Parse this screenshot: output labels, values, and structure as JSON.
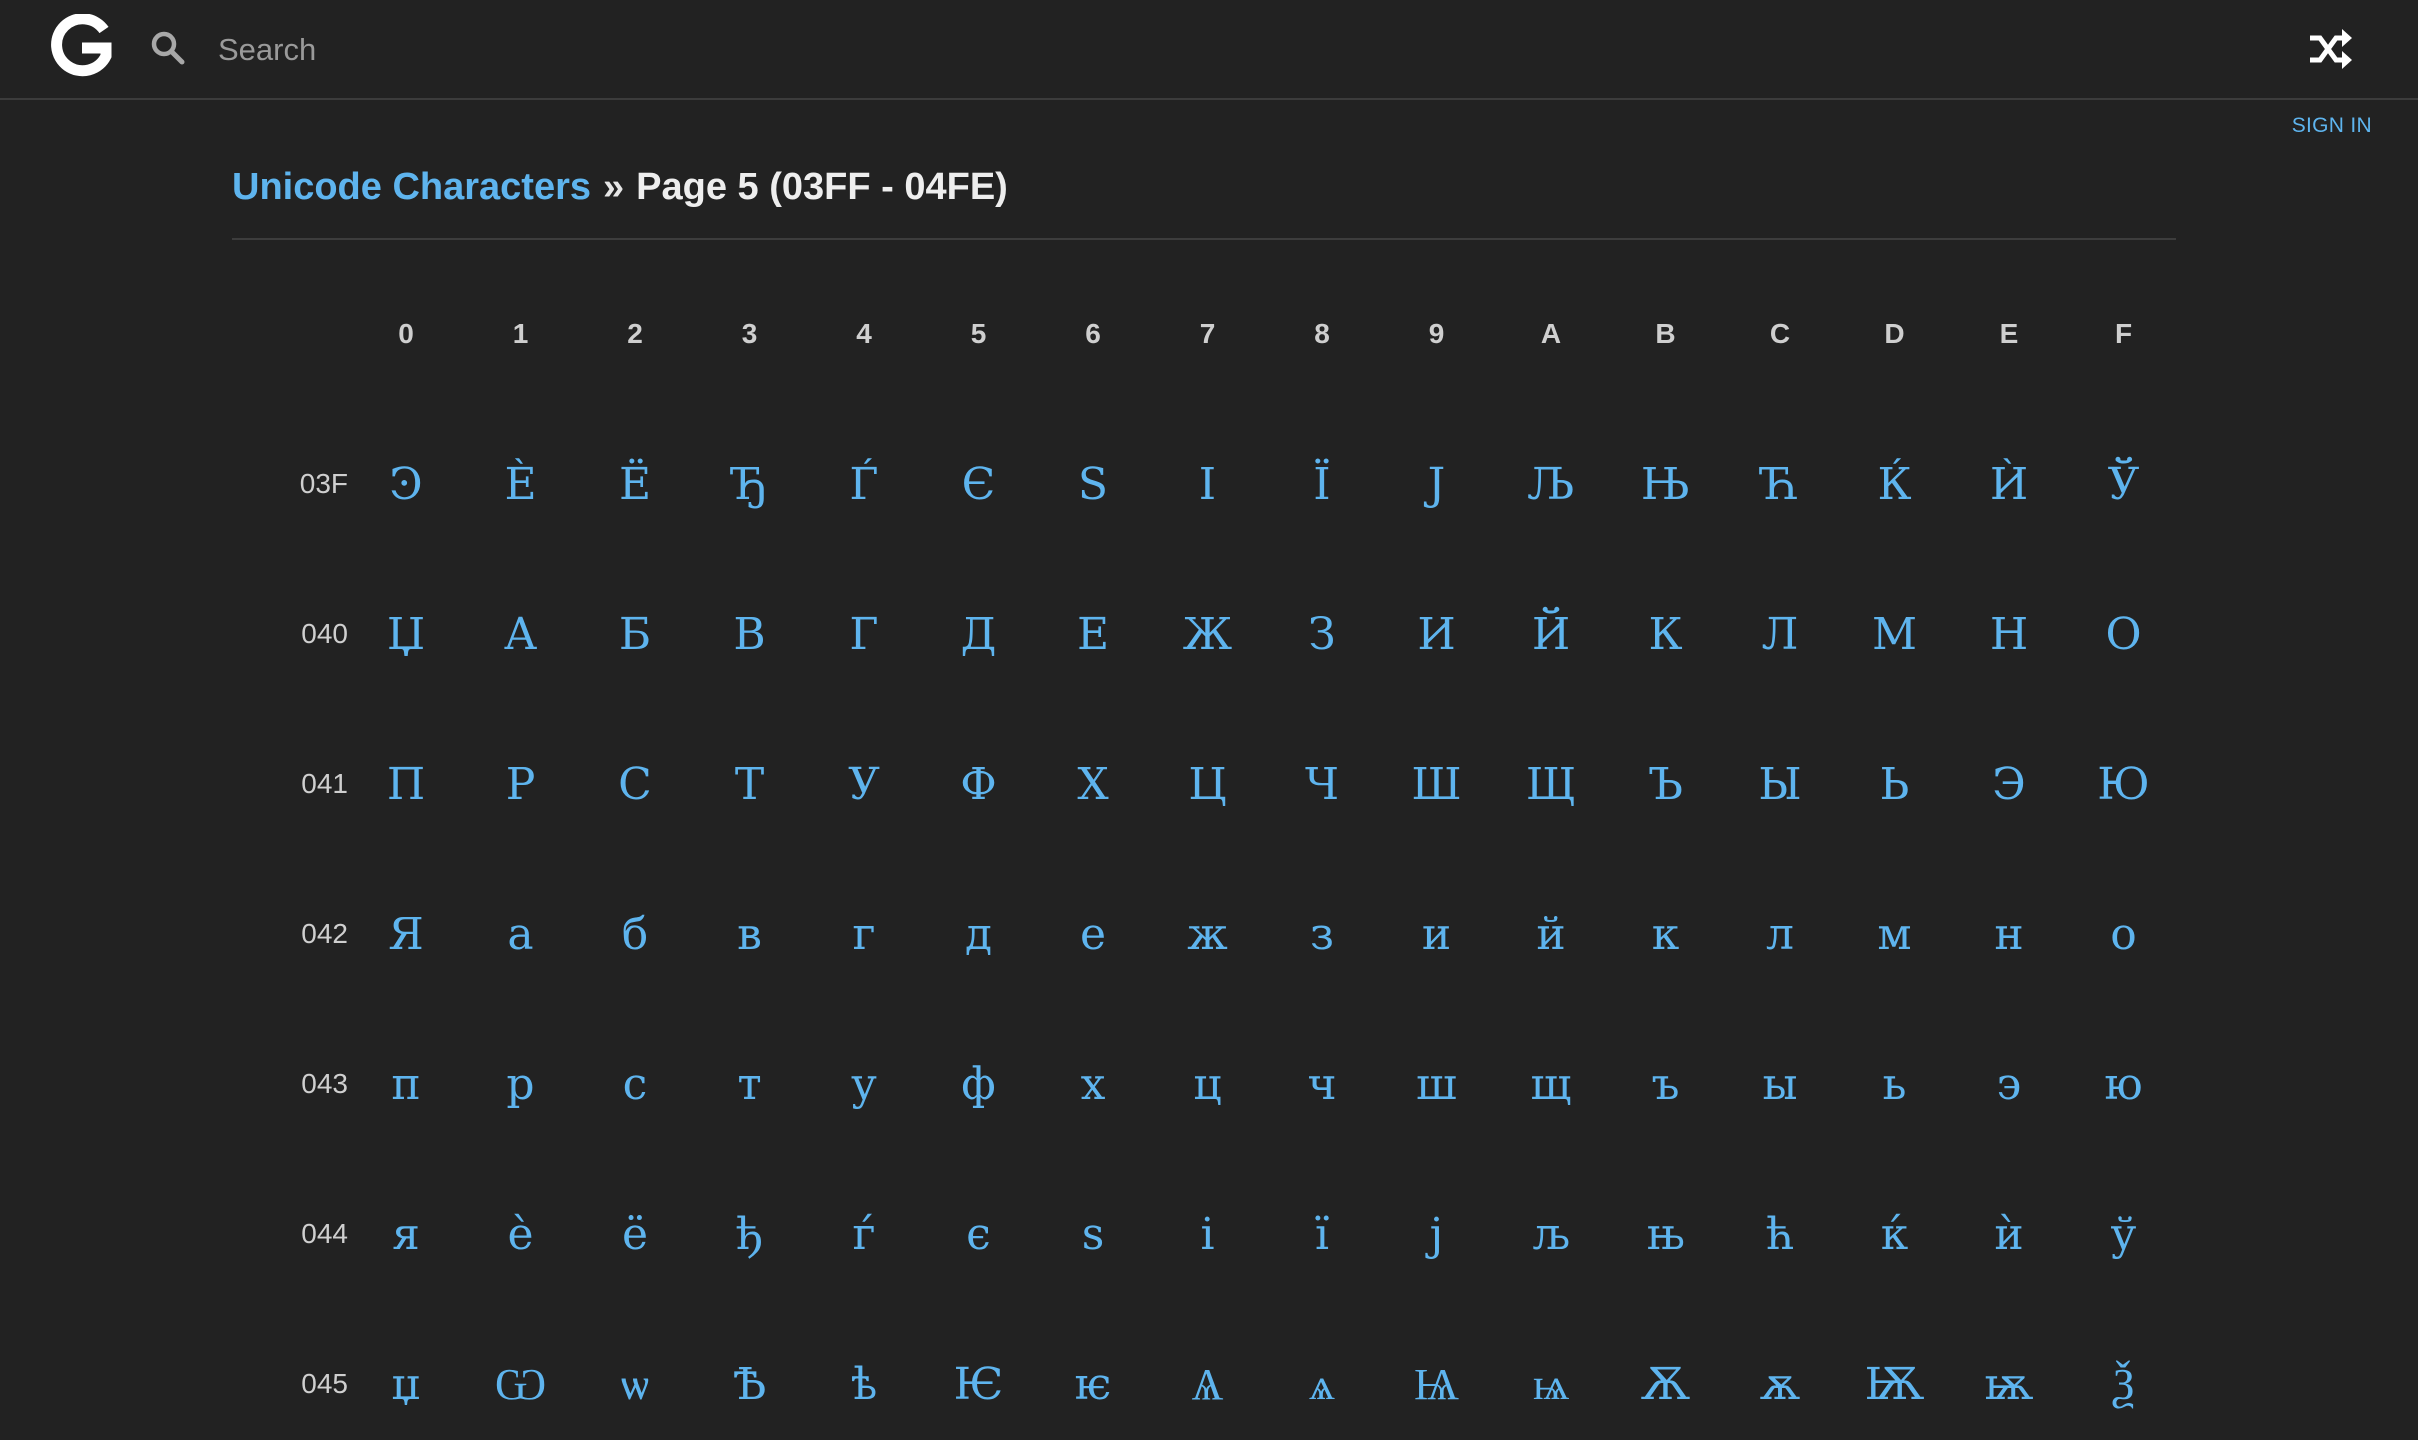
{
  "header": {
    "search_placeholder": "Search",
    "sign_in_label": "SIGN IN"
  },
  "breadcrumb": {
    "parent": "Unicode Characters",
    "separator": "»",
    "current": "Page 5 (03FF - 04FE)"
  },
  "colors": {
    "background": "#222222",
    "accent": "#5eb4ee",
    "text": "#eeeeee"
  },
  "grid": {
    "columns": [
      "0",
      "1",
      "2",
      "3",
      "4",
      "5",
      "6",
      "7",
      "8",
      "9",
      "A",
      "B",
      "C",
      "D",
      "E",
      "F"
    ],
    "rows": [
      {
        "label": "03F",
        "chars": [
          "Ͽ",
          "Ѐ",
          "Ё",
          "Ђ",
          "Ѓ",
          "Є",
          "Ѕ",
          "І",
          "Ї",
          "Ј",
          "Љ",
          "Њ",
          "Ћ",
          "Ќ",
          "Ѝ",
          "Ў"
        ]
      },
      {
        "label": "040",
        "chars": [
          "Џ",
          "А",
          "Б",
          "В",
          "Г",
          "Д",
          "Е",
          "Ж",
          "З",
          "И",
          "Й",
          "К",
          "Л",
          "М",
          "Н",
          "О"
        ]
      },
      {
        "label": "041",
        "chars": [
          "П",
          "Р",
          "С",
          "Т",
          "У",
          "Ф",
          "Х",
          "Ц",
          "Ч",
          "Ш",
          "Щ",
          "Ъ",
          "Ы",
          "Ь",
          "Э",
          "Ю"
        ]
      },
      {
        "label": "042",
        "chars": [
          "Я",
          "а",
          "б",
          "в",
          "г",
          "д",
          "е",
          "ж",
          "з",
          "и",
          "й",
          "к",
          "л",
          "м",
          "н",
          "о"
        ]
      },
      {
        "label": "043",
        "chars": [
          "п",
          "р",
          "с",
          "т",
          "у",
          "ф",
          "х",
          "ц",
          "ч",
          "ш",
          "щ",
          "ъ",
          "ы",
          "ь",
          "э",
          "ю"
        ]
      },
      {
        "label": "044",
        "chars": [
          "я",
          "ѐ",
          "ё",
          "ђ",
          "ѓ",
          "є",
          "ѕ",
          "і",
          "ї",
          "ј",
          "љ",
          "њ",
          "ћ",
          "ќ",
          "ѝ",
          "ў"
        ]
      },
      {
        "label": "045",
        "chars": [
          "џ",
          "Ѡ",
          "ѡ",
          "Ѣ",
          "ѣ",
          "Ѥ",
          "ѥ",
          "Ѧ",
          "ѧ",
          "Ѩ",
          "ѩ",
          "Ѫ",
          "ѫ",
          "Ѭ",
          "ѭ",
          "Ѯ"
        ]
      }
    ]
  }
}
